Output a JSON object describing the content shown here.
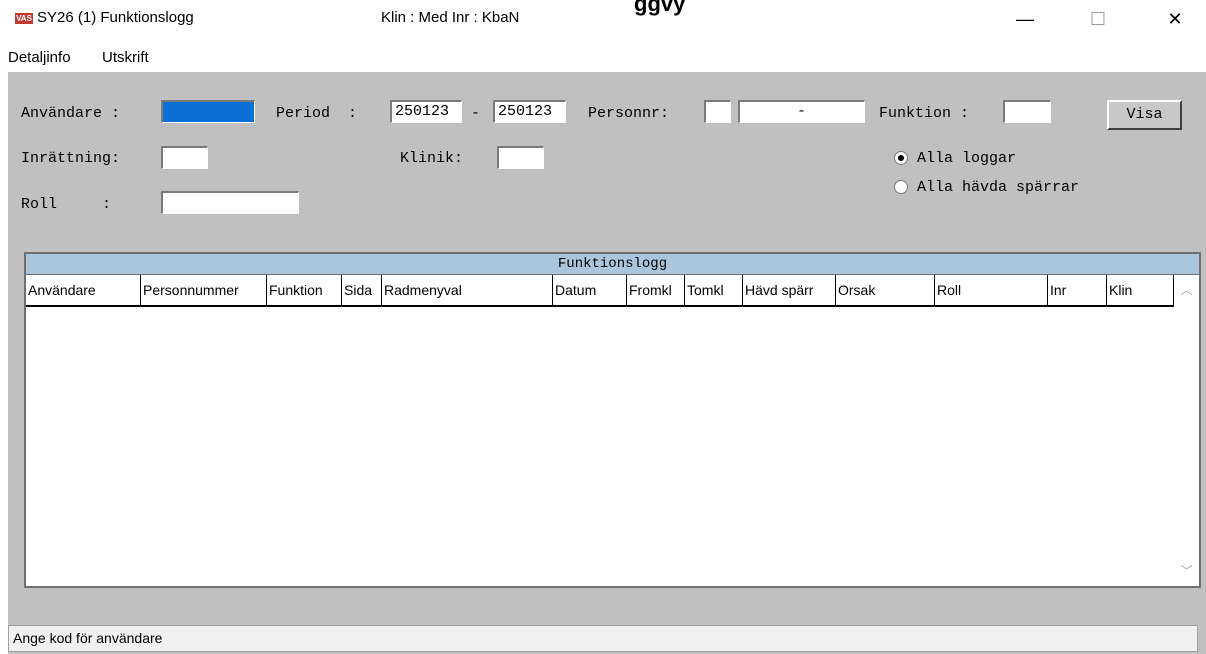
{
  "window": {
    "title": "SY26 (1) Funktionslogg",
    "context": "Klin : Med  Inr : KbaN",
    "caption_fragment": "ggvy",
    "icon_text": "VAS",
    "controls": {
      "minimize": "—",
      "maximize": "☐",
      "close": "✕"
    }
  },
  "menu": [
    "Detaljinfo",
    "Utskrift"
  ],
  "form": {
    "anvandare_label": "Användare :",
    "anvandare_value": "",
    "period_label": "Period  :",
    "period_from": "250123",
    "period_sep": "-",
    "period_to": "250123",
    "personnr_label": "Personnr:",
    "personnr_part1": "",
    "personnr_part2": "      -",
    "funktion_label": "Funktion :",
    "funktion_value": "",
    "visa_button": "Visa",
    "inrattning_label": "Inrättning:",
    "inrattning_value": "",
    "klinik_label": "Klinik:",
    "klinik_value": "",
    "roll_label": "Roll     :",
    "roll_value": "",
    "radio_all_logs": "Alla loggar",
    "radio_all_locks": "Alla hävda spärrar",
    "selected_radio": "all_logs"
  },
  "grid": {
    "title": "Funktionslogg",
    "columns": [
      "Användare",
      "Personnummer",
      "Funktion",
      "Sida",
      "Radmenyval",
      "Datum",
      "Fromkl",
      "Tomkl",
      "Hävd spärr",
      "Orsak",
      "Roll",
      "Inr",
      "Klin"
    ],
    "rows": []
  },
  "status": {
    "message": "Ange kod för användare"
  }
}
